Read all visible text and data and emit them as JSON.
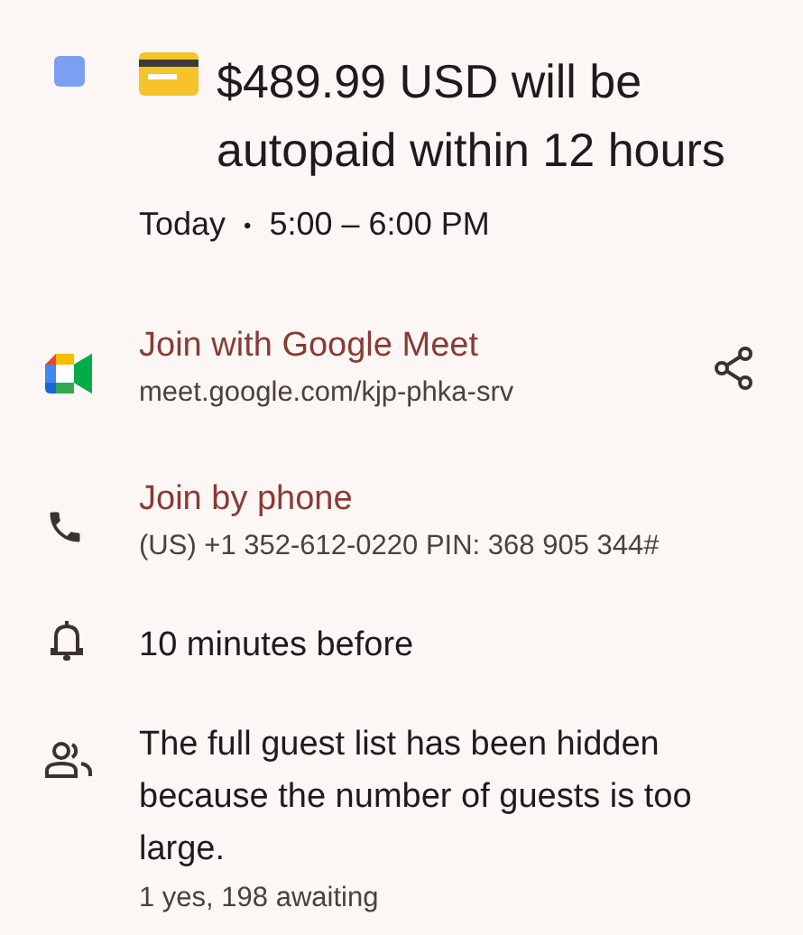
{
  "event": {
    "color": "#7ba0f2",
    "title": "$489.99 USD will be autopaid within 12 hours",
    "date": "Today",
    "separator": "•",
    "time": "5:00 – 6:00 PM"
  },
  "details": [
    {
      "kind": "meet",
      "title": "Join with Google Meet",
      "subtitle": "meet.google.com/kjp-phka-srv"
    },
    {
      "kind": "phone",
      "title": "Join by phone",
      "subtitle": "(US) +1 352-612-0220 PIN: 368 905 344#"
    },
    {
      "kind": "reminder",
      "text": "10 minutes before"
    },
    {
      "kind": "guests",
      "text": "The full guest list has been hidden because the number of guests is too large.",
      "subtitle": "1 yes, 198 awaiting"
    }
  ]
}
